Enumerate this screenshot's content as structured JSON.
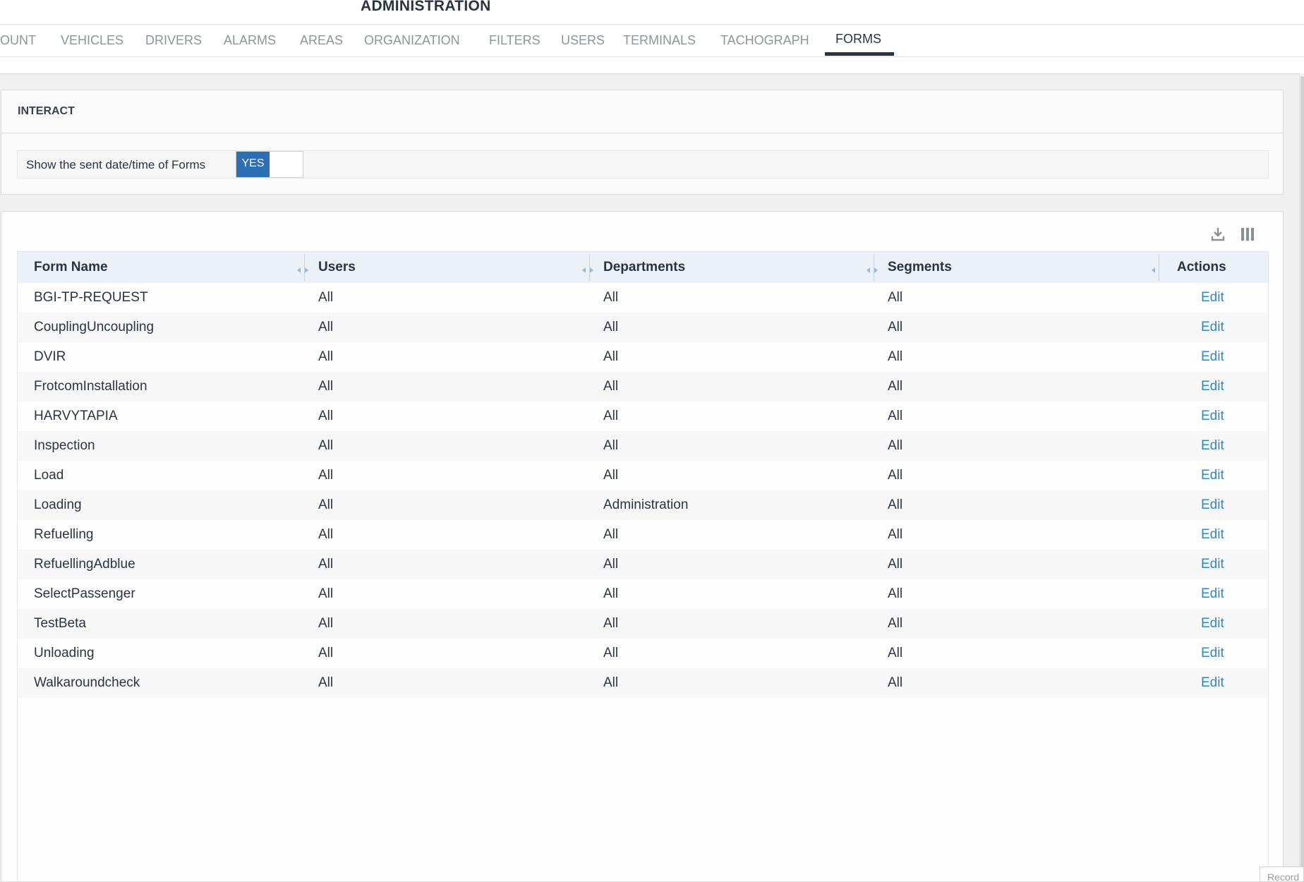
{
  "header": {
    "title": "ADMINISTRATION"
  },
  "tabs": [
    {
      "label": "OUNT"
    },
    {
      "label": "VEHICLES"
    },
    {
      "label": "DRIVERS"
    },
    {
      "label": "ALARMS"
    },
    {
      "label": "AREAS"
    },
    {
      "label": "ORGANIZATION"
    },
    {
      "label": "FILTERS"
    },
    {
      "label": "USERS"
    },
    {
      "label": "TERMINALS"
    },
    {
      "label": "TACHOGRAPH"
    },
    {
      "label": "FORMS",
      "active": true
    }
  ],
  "interact": {
    "title": "INTERACT",
    "setting_label": "Show the sent date/time of Forms",
    "toggle_value": "YES"
  },
  "toolbar": {
    "download_icon": "download-icon",
    "columns_icon": "columns-icon"
  },
  "table": {
    "columns": [
      "Form Name",
      "Users",
      "Departments",
      "Segments",
      "Actions"
    ],
    "action_label": "Edit",
    "rows": [
      {
        "form_name": "BGI-TP-REQUEST",
        "users": "All",
        "departments": "All",
        "segments": "All"
      },
      {
        "form_name": "CouplingUncoupling",
        "users": "All",
        "departments": "All",
        "segments": "All"
      },
      {
        "form_name": "DVIR",
        "users": "All",
        "departments": "All",
        "segments": "All"
      },
      {
        "form_name": "FrotcomInstallation",
        "users": "All",
        "departments": "All",
        "segments": "All"
      },
      {
        "form_name": "HARVYTAPIA",
        "users": "All",
        "departments": "All",
        "segments": "All"
      },
      {
        "form_name": "Inspection",
        "users": "All",
        "departments": "All",
        "segments": "All"
      },
      {
        "form_name": "Load",
        "users": "All",
        "departments": "All",
        "segments": "All"
      },
      {
        "form_name": "Loading",
        "users": "All",
        "departments": "Administration",
        "segments": "All"
      },
      {
        "form_name": "Refuelling",
        "users": "All",
        "departments": "All",
        "segments": "All"
      },
      {
        "form_name": "RefuellingAdblue",
        "users": "All",
        "departments": "All",
        "segments": "All"
      },
      {
        "form_name": "SelectPassenger",
        "users": "All",
        "departments": "All",
        "segments": "All"
      },
      {
        "form_name": "TestBeta",
        "users": "All",
        "departments": "All",
        "segments": "All"
      },
      {
        "form_name": "Unloading",
        "users": "All",
        "departments": "All",
        "segments": "All"
      },
      {
        "form_name": "Walkaroundcheck",
        "users": "All",
        "departments": "All",
        "segments": "All"
      }
    ]
  },
  "corner_widget": {
    "label": "Record"
  },
  "colors": {
    "accent": "#2d6fb5",
    "link": "#2f86c8",
    "header_bg": "#ecf1f8",
    "text": "#2a3441"
  }
}
